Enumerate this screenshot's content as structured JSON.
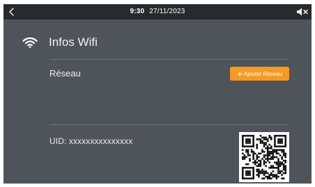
{
  "status_bar": {
    "back_icon": "chevron-left-icon",
    "time": "9:30",
    "date": "27/11/2023",
    "volume_icon": "speaker-muted-icon"
  },
  "header": {
    "icon": "wifi-icon",
    "title": "Infos Wifi"
  },
  "network": {
    "label": "Réseau",
    "add_button_icon": "plus-icon",
    "add_button_label": "Ajouter Réseau"
  },
  "device": {
    "uid_text": "UID: xxxxxxxxxxxxxxx",
    "qr_icon": "qr-code"
  },
  "colors": {
    "background": "#4e5459",
    "status_bar": "#272a2d",
    "accent": "#f59a25",
    "text": "#eef0f1"
  }
}
